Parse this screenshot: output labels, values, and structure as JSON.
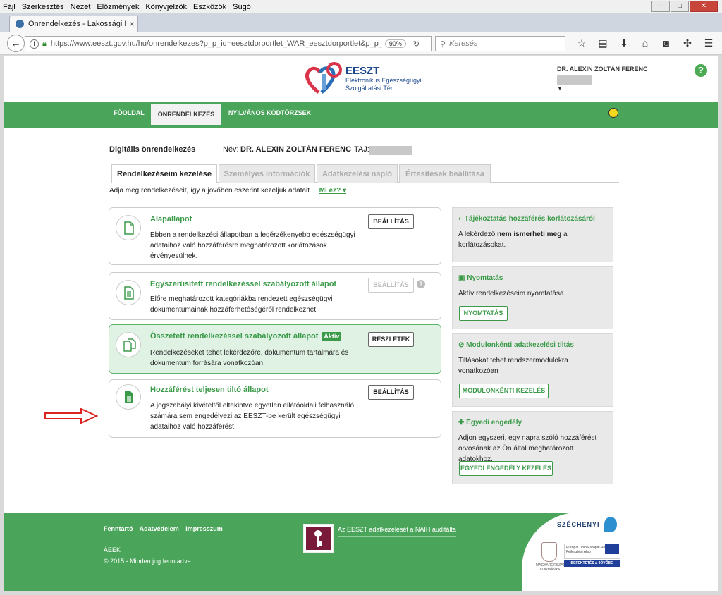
{
  "browser": {
    "menu": [
      "Fájl",
      "Szerkesztés",
      "Nézet",
      "Előzmények",
      "Könyvjelzők",
      "Eszközök",
      "Súgó"
    ],
    "tab_title": "Önrendelkezés - Lakossági Po",
    "url": "https://www.eeszt.gov.hu/hu/onrendelkezes?p_p_id=eesztdorportlet_WAR_eesztdorportlet&p_p_lifecycle",
    "zoom": "90%",
    "search_placeholder": "Keresés"
  },
  "header": {
    "logo_title": "EESZT",
    "logo_sub1": "Elektronikus Egészségügyi",
    "logo_sub2": "Szolgáltatási Tér",
    "user_name": "DR. ALEXIN ZOLTÁN FERENC",
    "help": "?"
  },
  "nav": {
    "items": [
      "FŐOLDAL",
      "ÖNRENDELKEZÉS",
      "NYILVÁNOS KÓDTÖRZSEK"
    ]
  },
  "main": {
    "title": "Digitális önrendelkezés",
    "name_label": "Név:",
    "name_value": "DR. ALEXIN ZOLTÁN FERENC",
    "taj_label": "TAJ:",
    "tabs": [
      "Rendelkezéseim kezelése",
      "Személyes információk",
      "Adatkezelési napló",
      "Értesítések beállítása"
    ],
    "subtitle": "Adja meg rendelkezéseit, így a jövőben eszerint kezeljük adatait.",
    "mi_ez": "Mi ez?",
    "cards": [
      {
        "title": "Alapállapot",
        "text": "Ebben a rendelkezési állapotban a legérzékenyebb egészségügyi adataihoz való hozzáférésre meghatározott korlátozások érvényesülnek.",
        "button": "BEÁLLÍTÁS"
      },
      {
        "title": "Egyszerűsített rendelkezéssel szabályozott állapot",
        "text": "Előre meghatározott kategóriákba rendezett egészségügyi dokumentumainak hozzáférhetőségéről rendelkezhet.",
        "button": "BEÁLLÍTÁS"
      },
      {
        "title": "Összetett rendelkezéssel szabályozott állapot",
        "badge": "Aktív",
        "text": "Rendelkezéseket tehet lekérdezőre, dokumentum tartalmára és dokumentum forrására vonatkozóan.",
        "button": "RÉSZLETEK"
      },
      {
        "title": "Hozzáférést teljesen tiltó állapot",
        "text": "A jogszabályi kivételtől eltekintve egyetlen ellátóoldali felhasználó számára sem engedélyezi az EESZT-be került egészségügyi adataihoz való hozzáférést.",
        "button": "BEÁLLÍTÁS"
      }
    ]
  },
  "side": [
    {
      "title": "Tájékoztatás hozzáférés korlátozásáról",
      "text_pre": "A lekérdező ",
      "text_bold": "nem ismerheti meg",
      "text_post": " a korlátozásokat."
    },
    {
      "title": "Nyomtatás",
      "text": "Aktív rendelkezéseim nyomtatása.",
      "button": "NYOMTATÁS"
    },
    {
      "title": "Modulonkénti adatkezelési tiltás",
      "text": "Tiltásokat tehet rendszermodulokra vonatkozóan",
      "button": "MODULONKÉNTI KEZELÉS"
    },
    {
      "title": "Egyedi engedély",
      "text": "Adjon egyszeri, egy napra szóló hozzáférést orvosának az Ön által meghatározott adatokhoz.",
      "button": "EGYEDI ENGEDÉLY KEZELÉS"
    }
  ],
  "footer": {
    "links": [
      "Fenntartó",
      "Adatvédelem",
      "Impresszum"
    ],
    "naih": "Az EESZT adatkezelését a NAIH auditálta",
    "org": "ÁEEK",
    "copyright": "© 2015 - Minden jog fenntartva",
    "szechenyi": "SZÉCHENYI",
    "mk": "MAGYARORSZÁG KORMÁNYA",
    "eu": "Európai Unió Európai Regionális Fejlesztési Alap",
    "eu_bar": "BEFEKTETÉS A JÖVŐBE"
  },
  "colors": {
    "brand_green": "#4aa55a",
    "title_green": "#3a9a48",
    "highlight_bg": "#dff2e4",
    "arrow_red": "#d22"
  }
}
